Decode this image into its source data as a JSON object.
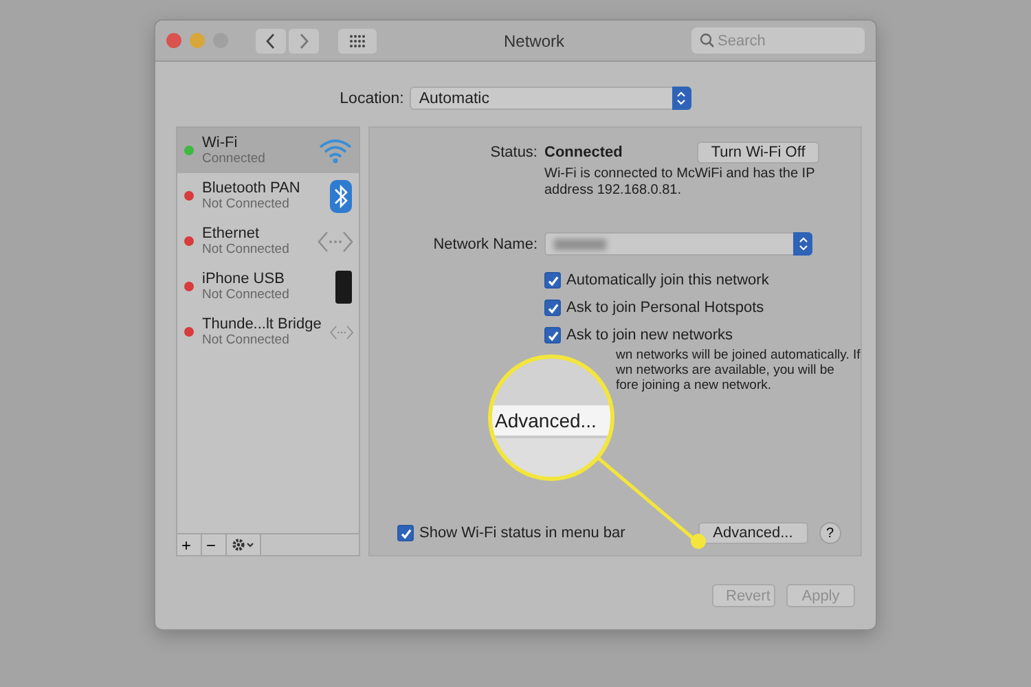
{
  "window": {
    "title": "Network"
  },
  "search": {
    "placeholder": "Search"
  },
  "location": {
    "label": "Location:",
    "value": "Automatic"
  },
  "services": [
    {
      "name": "Wi-Fi",
      "status": "Connected",
      "color": "#3db93d",
      "kind": "wifi",
      "selected": true
    },
    {
      "name": "Bluetooth PAN",
      "status": "Not Connected",
      "color": "#d83b3b",
      "kind": "bluetooth",
      "selected": false
    },
    {
      "name": "Ethernet",
      "status": "Not Connected",
      "color": "#d83b3b",
      "kind": "ethernet",
      "selected": false
    },
    {
      "name": "iPhone USB",
      "status": "Not Connected",
      "color": "#d83b3b",
      "kind": "phone",
      "selected": false
    },
    {
      "name": "Thunde...lt Bridge",
      "status": "Not Connected",
      "color": "#d83b3b",
      "kind": "ethernet",
      "selected": false
    }
  ],
  "sidebar_toolbar": [
    "+",
    "−"
  ],
  "status": {
    "label": "Status:",
    "value": "Connected",
    "button": "Turn Wi-Fi Off",
    "description": "Wi-Fi is connected to McWiFi and has the IP address 192.168.0.81."
  },
  "network_name": {
    "label": "Network Name:"
  },
  "options": [
    {
      "label": "Automatically join this network",
      "checked": true
    },
    {
      "label": "Ask to join Personal Hotspots",
      "checked": true
    },
    {
      "label": "Ask to join new networks",
      "checked": true
    }
  ],
  "note_lines": [
    "wn networks will be joined automatically. If",
    "wn networks are available, you will be",
    "fore joining a new network."
  ],
  "show_status": {
    "label": "Show Wi-Fi status in menu bar",
    "checked": true
  },
  "advanced_button": "Advanced...",
  "help_button": "?",
  "magnifier": {
    "text": "Advanced..."
  },
  "footer_buttons": [
    {
      "label": "Revert",
      "disabled": true
    },
    {
      "label": "Apply",
      "disabled": true
    }
  ]
}
